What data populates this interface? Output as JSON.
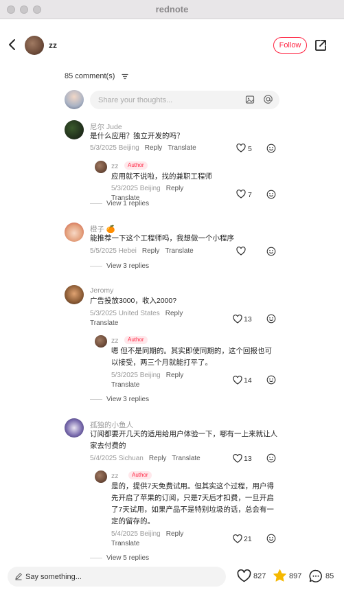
{
  "window": {
    "title": "rednote"
  },
  "header": {
    "author": "zz",
    "follow_label": "Follow"
  },
  "comments_header": {
    "count_text": "85 comment(s)"
  },
  "composer": {
    "placeholder": "Share your thoughts..."
  },
  "labels": {
    "reply": "Reply",
    "translate": "Translate",
    "author_badge": "Author"
  },
  "comments": [
    {
      "user": "尼尔 Jude",
      "text": "是什么应用？独立开发的吗？",
      "date": "5/3/2025 Beijing",
      "likes": "5",
      "reply": {
        "user": "zz",
        "text": "应用就不说啦，找的兼职工程师",
        "date": "5/3/2025 Beijing",
        "likes": "7"
      },
      "view_replies": "View 1 replies"
    },
    {
      "user": "橙子",
      "user_emoji": "🍊",
      "text": "能推荐一下这个工程师吗，我想做一个小程序",
      "date": "5/5/2025 Hebei",
      "likes": "",
      "view_replies": "View 3 replies"
    },
    {
      "user": "Jeromy",
      "text": "广告投放3000，收入2000?",
      "date": "5/3/2025 United States",
      "likes": "13",
      "reply": {
        "user": "zz",
        "text": "嗯 但不是同期的。其实即使同期的，这个回报也可以接受，两三个月就能打平了。",
        "date": "5/3/2025 Beijing",
        "likes": "14"
      },
      "view_replies": "View 3 replies"
    },
    {
      "user": "孤独的小鱼人",
      "text": "订阅都要开几天的适用给用户体验一下，哪有一上来就让人家去付费的",
      "date": "5/4/2025 Sichuan",
      "likes": "13",
      "reply": {
        "user": "zz",
        "text": "是的，提供7天免费试用。但其实这个过程，用户得先开启了苹果的订阅，只是7天后才扣费，一旦开启了7天试用，如果产品不是特别垃圾的话，总会有一定的留存的。",
        "date": "5/4/2025 Beijing",
        "likes": "21"
      },
      "view_replies": "View 5 replies"
    }
  ],
  "bottom_bar": {
    "placeholder": "Say something...",
    "likes": "827",
    "collects": "897",
    "comments": "85"
  },
  "colors": {
    "brand": "#ff2442",
    "star": "#f5b800"
  }
}
